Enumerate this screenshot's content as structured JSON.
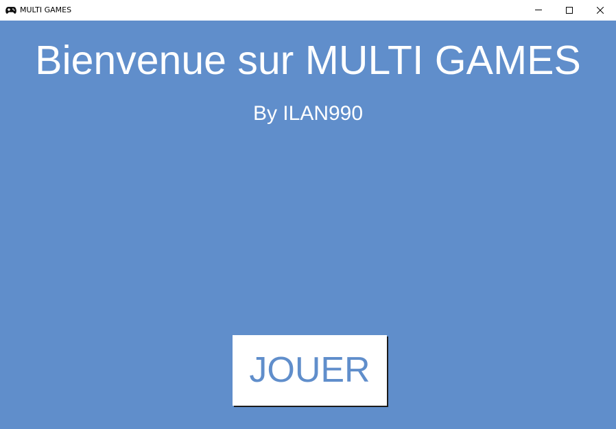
{
  "window": {
    "title": "MULTI GAMES",
    "icon": "gamepad-icon",
    "controls": {
      "minimize": "minimize-icon",
      "maximize": "maximize-icon",
      "close": "close-icon"
    }
  },
  "main": {
    "title": "Bienvenue sur MULTI GAMES",
    "subtitle": "By ILAN990",
    "play_button_label": "JOUER"
  },
  "colors": {
    "background": "#608ecb",
    "text": "#ffffff",
    "button_background": "#ffffff",
    "button_text": "#608ecb"
  }
}
